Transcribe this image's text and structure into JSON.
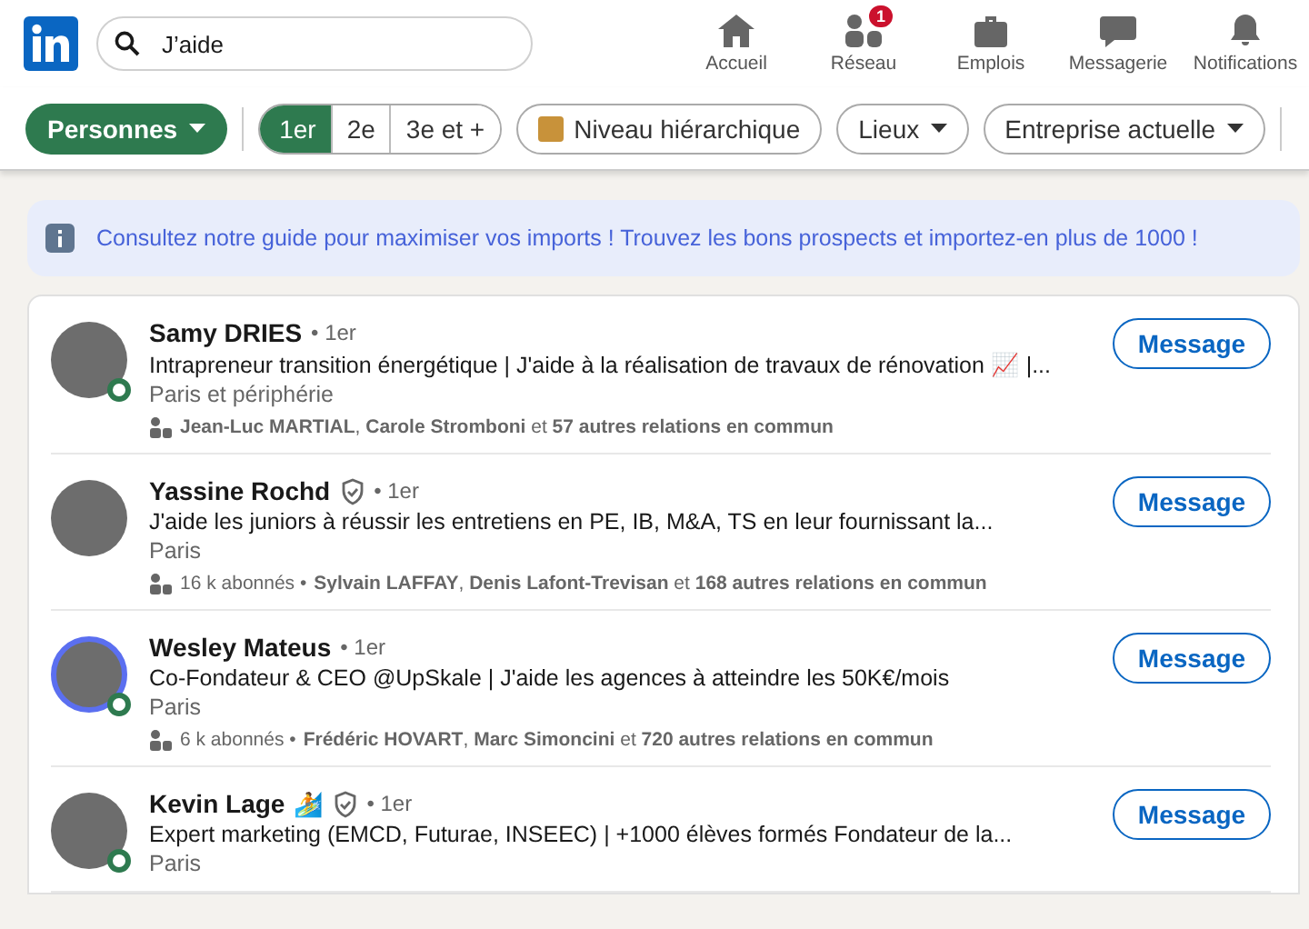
{
  "search": {
    "value": "J’aide"
  },
  "nav": [
    {
      "kind": "home",
      "label": "Accueil"
    },
    {
      "kind": "network",
      "label": "Réseau",
      "badge": "1"
    },
    {
      "kind": "jobs",
      "label": "Emplois"
    },
    {
      "kind": "messaging",
      "label": "Messagerie"
    },
    {
      "kind": "bell",
      "label": "Notifications"
    }
  ],
  "filters": {
    "type": {
      "label": "Personnes"
    },
    "degrees": [
      {
        "label": "1er",
        "selected": true
      },
      {
        "label": "2e",
        "selected": false
      },
      {
        "label": "3e et +",
        "selected": false
      }
    ],
    "chips": [
      {
        "kind": "icon",
        "label": "Niveau hiérarchique"
      },
      {
        "kind": "dropdown",
        "label": "Lieux"
      },
      {
        "kind": "dropdown",
        "label": "Entreprise actuelle"
      }
    ]
  },
  "banner": {
    "text": "Consultez notre guide pour maximiser vos imports ! Trouvez les bons prospects et importez-en plus de 1000 !"
  },
  "results": [
    {
      "name": "Samy DRIES",
      "verified": false,
      "degree": "• 1er",
      "headline": "Intrapreneur transition énergétique | J'aide à la réalisation de travaux de rénovation 📈 |...",
      "location": "Paris et périphérie",
      "mutual": "**Jean-Luc MARTIAL**, **Carole Stromboni** et **57 autres relations en commun**",
      "online": true,
      "ring": false,
      "button": "Message"
    },
    {
      "name": "Yassine Rochd",
      "verified": true,
      "degree": "• 1er",
      "headline": "J'aide les juniors à réussir les entretiens en PE, IB, M&A, TS en leur fournissant la...",
      "location": "Paris",
      "followers": "16 k abonnés •",
      "mutual": "**Sylvain LAFFAY**, **Denis Lafont-Trevisan** et **168 autres relations en commun**",
      "online": false,
      "ring": false,
      "button": "Message"
    },
    {
      "name": "Wesley Mateus",
      "verified": false,
      "degree": "• 1er",
      "headline": "Co-Fondateur & CEO @UpSkale | J'aide les agences à atteindre les 50K€/mois",
      "location": "Paris",
      "followers": "6 k abonnés •",
      "mutual": "**Frédéric HOVART**, **Marc Simoncini** et **720 autres relations en commun**",
      "online": true,
      "ring": true,
      "button": "Message"
    },
    {
      "name": "Kevin Lage",
      "verified": true,
      "emoji": "🏄",
      "degree": "• 1er",
      "headline": "Expert marketing (EMCD, Futurae, INSEEC) | +1000 élèves formés Fondateur de la...",
      "location": "Paris",
      "online": true,
      "ring": false,
      "button": "Message"
    }
  ]
}
